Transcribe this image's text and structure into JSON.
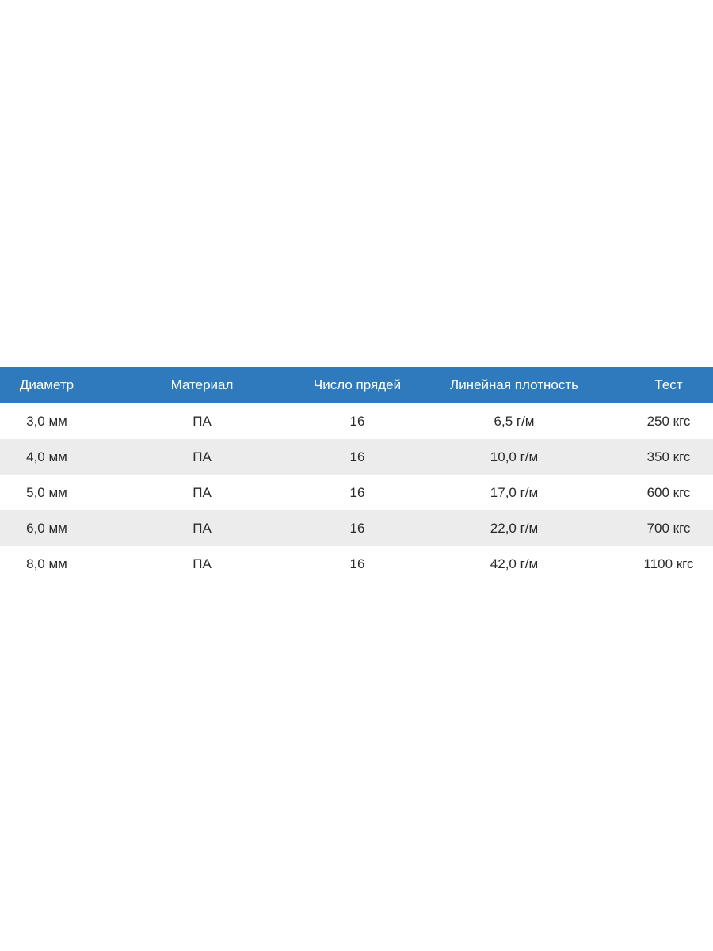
{
  "table": {
    "headers": [
      "Диаметр",
      "Материал",
      "Число прядей",
      "Линейная плотность",
      "Тест"
    ],
    "rows": [
      [
        "3,0 мм",
        "ПА",
        "16",
        "6,5 г/м",
        "250 кгс"
      ],
      [
        "4,0 мм",
        "ПА",
        "16",
        "10,0 г/м",
        "350 кгс"
      ],
      [
        "5,0 мм",
        "ПА",
        "16",
        "17,0 г/м",
        "600 кгс"
      ],
      [
        "6,0 мм",
        "ПА",
        "16",
        "22,0 г/м",
        "700 кгс"
      ],
      [
        "8,0 мм",
        "ПА",
        "16",
        "42,0 г/м",
        "1100 кгс"
      ]
    ]
  },
  "colors": {
    "header_bg": "#2f79bd",
    "header_text": "#ffffff",
    "stripe_bg": "#ececec",
    "cell_text": "#2a2a2a"
  }
}
